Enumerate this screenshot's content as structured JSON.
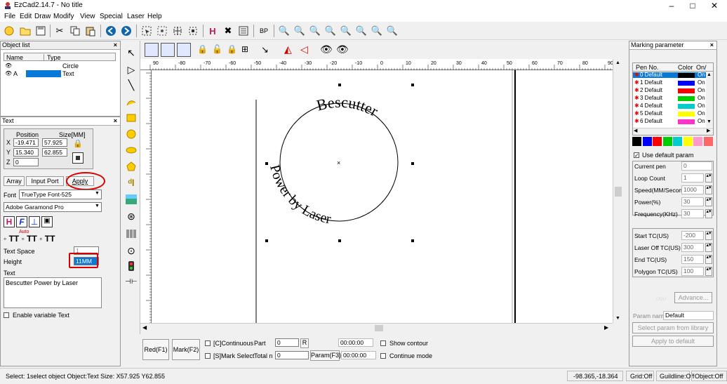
{
  "window": {
    "title": "EzCad2.14.7 - No title"
  },
  "menu": [
    "File",
    "Edit",
    "Draw",
    "Modify",
    "View",
    "Special",
    "Laser",
    "Help"
  ],
  "object_list": {
    "title": "Object list",
    "col_name": "Name",
    "col_type": "Type",
    "rows": [
      {
        "name": "",
        "type": "Circle"
      },
      {
        "name": "A",
        "type": "Text"
      }
    ]
  },
  "text_panel": {
    "title": "Text",
    "position_label": "Position",
    "size_label": "Size[MM]",
    "x_label": "X",
    "y_label": "Y",
    "z_label": "Z",
    "x_pos": "-19.471",
    "y_pos": "15.340",
    "z_pos": "0",
    "x_size": "57.925",
    "y_size": "62.855",
    "tab_array": "Array",
    "tab_input_port": "Input Port",
    "apply": "Apply",
    "font_label": "Font",
    "font_type": "TrueType Font-525",
    "font_name": "Adobe Garamond Pro",
    "auto_label": "Auto",
    "text_space_label": "Text Space",
    "text_space_value": "1",
    "height_label": "Height",
    "height_value": "11MM",
    "text_label": "Text",
    "text_value": "Bescutter Power by Laser",
    "enable_variable": "Enable variable Text"
  },
  "canvas": {
    "arc_text_top": "Bescutter",
    "arc_text_bottom": "Power by Laser",
    "ruler_labels": [
      "90",
      "-80",
      "-70",
      "-60",
      "-50",
      "-40",
      "-30",
      "-20",
      "-10",
      "0",
      "10",
      "20",
      "30",
      "40",
      "50",
      "60",
      "70",
      "80",
      "90"
    ]
  },
  "marking": {
    "title": "Marking parameter",
    "col_pen": "Pen No.",
    "col_color": "Color",
    "col_onoff": "On/",
    "pens": [
      {
        "name": "0 Default",
        "color": "#000000",
        "on": "On"
      },
      {
        "name": "1 Default",
        "color": "#0000ff",
        "on": "On"
      },
      {
        "name": "2 Default",
        "color": "#ff0000",
        "on": "On"
      },
      {
        "name": "3 Default",
        "color": "#00cc00",
        "on": "On"
      },
      {
        "name": "4 Default",
        "color": "#00cccc",
        "on": "On"
      },
      {
        "name": "5 Default",
        "color": "#ffff00",
        "on": "On"
      },
      {
        "name": "6 Default",
        "color": "#ff33cc",
        "on": "On"
      }
    ],
    "swatches": [
      "#000000",
      "#0000ff",
      "#ff0000",
      "#00cc00",
      "#00cccc",
      "#ffff00",
      "#ff99cc",
      "#ff6666"
    ],
    "use_default": "Use default param",
    "current_pen_label": "Current pen",
    "current_pen": "0",
    "loop_count_label": "Loop Count",
    "loop_count": "1",
    "speed_label": "Speed(MM/Secon",
    "speed": "1000",
    "power_label": "Power(%)",
    "power": "30",
    "freq_label": "Frequency(KHz)",
    "freq": "30",
    "start_tc_label": "Start TC(US)",
    "start_tc": "-200",
    "laser_off_label": "Laser Off TC(US)",
    "laser_off": "300",
    "end_tc_label": "End TC(US)",
    "end_tc": "150",
    "polygon_tc_label": "Polygon TC(US)",
    "polygon_tc": "100",
    "advance": "Advance...",
    "param_name_label": "Param name",
    "param_name": "Default",
    "select_param": "Select param from library",
    "apply_default": "Apply to default"
  },
  "bottom": {
    "red": "Red(F1)",
    "mark": "Mark(F2)",
    "continuous": "[C]Continuous",
    "part_label": "Part",
    "part_value": "0",
    "r_btn": "R",
    "time1": "00:00:00",
    "show_contour": "Show contour",
    "mark_select": "[S]Mark Select",
    "total_label": "Total n",
    "total_value": "0",
    "param_btn": "Param(F3)",
    "time2": "00:00:00",
    "continue_mode": "Continue mode"
  },
  "status": {
    "message": "Select: 1select object Object:Text Size: X57.925 Y62.855",
    "coords": "-98.365,-18.364",
    "grid": "Grid:Off",
    "guideline": "Guildline:Off",
    "object": "Object:Off"
  }
}
